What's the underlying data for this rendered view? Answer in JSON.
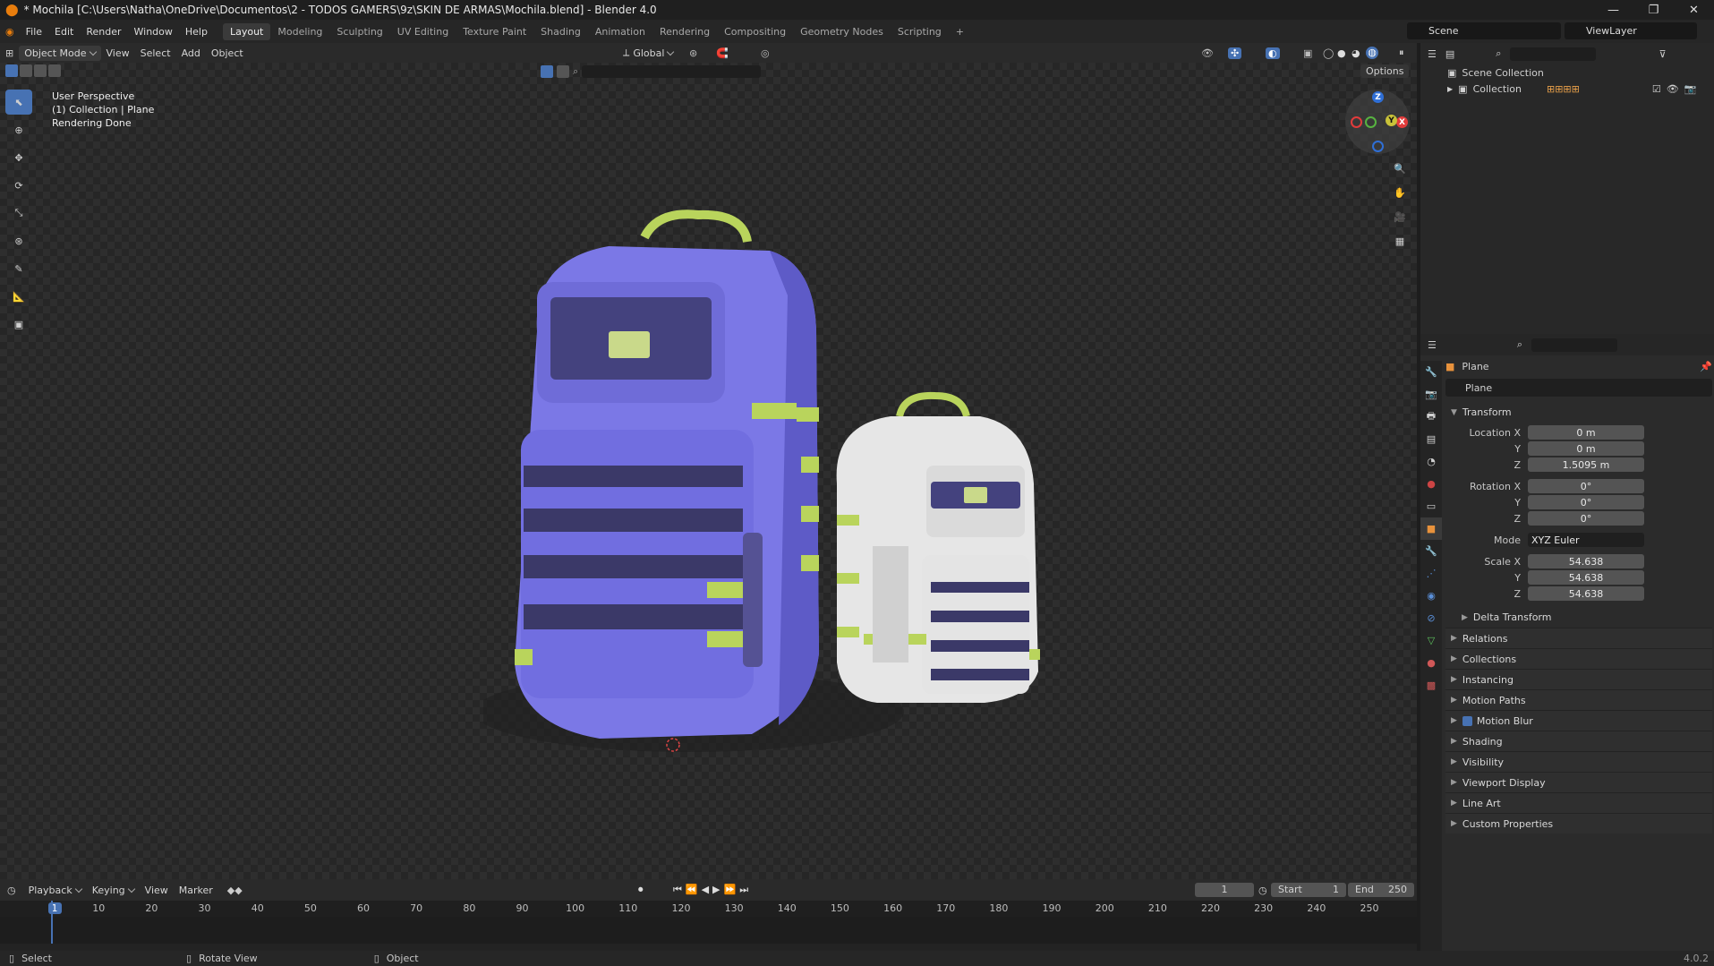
{
  "window": {
    "title": "* Mochila [C:\\Users\\Natha\\OneDrive\\Documentos\\2 - TODOS GAMERS\\9z\\SKIN DE ARMAS\\Mochila.blend] - Blender 4.0",
    "minimize": "—",
    "maximize": "❐",
    "close": "✕"
  },
  "menu": [
    "File",
    "Edit",
    "Render",
    "Window",
    "Help"
  ],
  "workspaces": [
    "Layout",
    "Modeling",
    "Sculpting",
    "UV Editing",
    "Texture Paint",
    "Shading",
    "Animation",
    "Rendering",
    "Compositing",
    "Geometry Nodes",
    "Scripting",
    "+"
  ],
  "active_workspace": "Layout",
  "scene_field": "Scene",
  "viewlayer_field": "ViewLayer",
  "viewport_header": {
    "mode": "Object Mode",
    "menus": [
      "View",
      "Select",
      "Add",
      "Object"
    ],
    "orientation": "Global",
    "options": "Options"
  },
  "viewport_overlay": {
    "line1": "User Perspective",
    "line2": "(1) Collection | Plane",
    "line3": "Rendering Done"
  },
  "gizmo": {
    "x": "X",
    "y": "Y",
    "z": "Z"
  },
  "outliner": {
    "root": "Scene Collection",
    "child": "Collection"
  },
  "properties": {
    "object_name": "Plane",
    "data_name": "Plane",
    "transform_header": "Transform",
    "rows": [
      {
        "label": "Location X",
        "value": "0 m"
      },
      {
        "label": "Y",
        "value": "0 m"
      },
      {
        "label": "Z",
        "value": "1.5095 m"
      },
      {
        "label": "Rotation X",
        "value": "0°"
      },
      {
        "label": "Y",
        "value": "0°"
      },
      {
        "label": "Z",
        "value": "0°"
      },
      {
        "label": "Mode",
        "value": "XYZ Euler"
      },
      {
        "label": "Scale X",
        "value": "54.638"
      },
      {
        "label": "Y",
        "value": "54.638"
      },
      {
        "label": "Z",
        "value": "54.638"
      }
    ],
    "delta": "Delta Transform",
    "sections": [
      "Relations",
      "Collections",
      "Instancing",
      "Motion Paths",
      "Motion Blur",
      "Shading",
      "Visibility",
      "Viewport Display",
      "Line Art",
      "Custom Properties"
    ]
  },
  "timeline": {
    "menus": [
      "Playback",
      "Keying",
      "View",
      "Marker"
    ],
    "current_frame": "1",
    "start_label": "Start",
    "start": "1",
    "end_label": "End",
    "end": "250",
    "ticks": [
      "1",
      "10",
      "20",
      "30",
      "40",
      "50",
      "60",
      "70",
      "80",
      "90",
      "100",
      "110",
      "120",
      "130",
      "140",
      "150",
      "160",
      "170",
      "180",
      "190",
      "200",
      "210",
      "220",
      "230",
      "240",
      "250"
    ]
  },
  "statusbar": {
    "select": "Select",
    "rotate": "Rotate View",
    "object": "Object",
    "version": "4.0.2"
  },
  "colors": {
    "accent": "#4772b3",
    "backpack_big": "#7b78e6",
    "strap_green": "#b9d45c"
  }
}
